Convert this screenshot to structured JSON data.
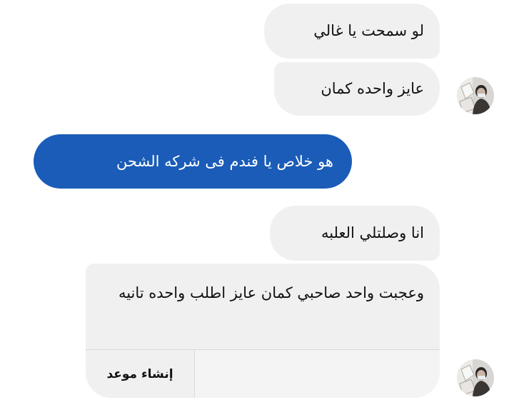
{
  "conversation": {
    "messages": [
      {
        "direction": "incoming",
        "text": "لو سمحت يا غالي"
      },
      {
        "direction": "incoming",
        "text": "عايز واحده كمان"
      },
      {
        "direction": "outgoing",
        "text": "هو خلاص يا فندم فى شركه الشحن"
      },
      {
        "direction": "incoming",
        "text": "انا وصلتلي العلبه"
      },
      {
        "direction": "incoming",
        "text": "وعجبت واحد صاحبي كمان عايز اطلب واحده تانيه",
        "action_label": "إنشاء موعد"
      }
    ]
  },
  "colors": {
    "incoming_bubble": "#f0f0f0",
    "outgoing_bubble": "#1a5cb8"
  },
  "icons": {
    "contact_avatar": "contact-avatar-photo"
  }
}
